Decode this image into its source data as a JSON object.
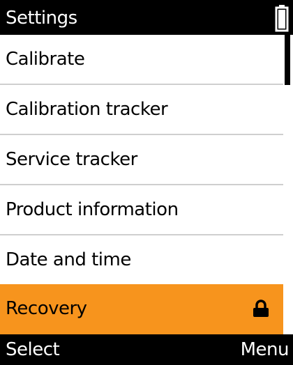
{
  "header": {
    "title": "Settings",
    "battery_icon": "battery-icon"
  },
  "menu": {
    "items": [
      {
        "label": "Calibrate",
        "selected": false,
        "locked": false
      },
      {
        "label": "Calibration tracker",
        "selected": false,
        "locked": false
      },
      {
        "label": "Service tracker",
        "selected": false,
        "locked": false
      },
      {
        "label": "Product information",
        "selected": false,
        "locked": false
      },
      {
        "label": "Date and time",
        "selected": false,
        "locked": false
      },
      {
        "label": "Recovery",
        "selected": true,
        "locked": true,
        "icon": "lock-icon"
      }
    ]
  },
  "softkeys": {
    "left_label": "Select",
    "right_label": "Menu"
  },
  "colors": {
    "selected_bg": "#f7941d",
    "background": "#000000",
    "list_bg": "#ffffff"
  }
}
